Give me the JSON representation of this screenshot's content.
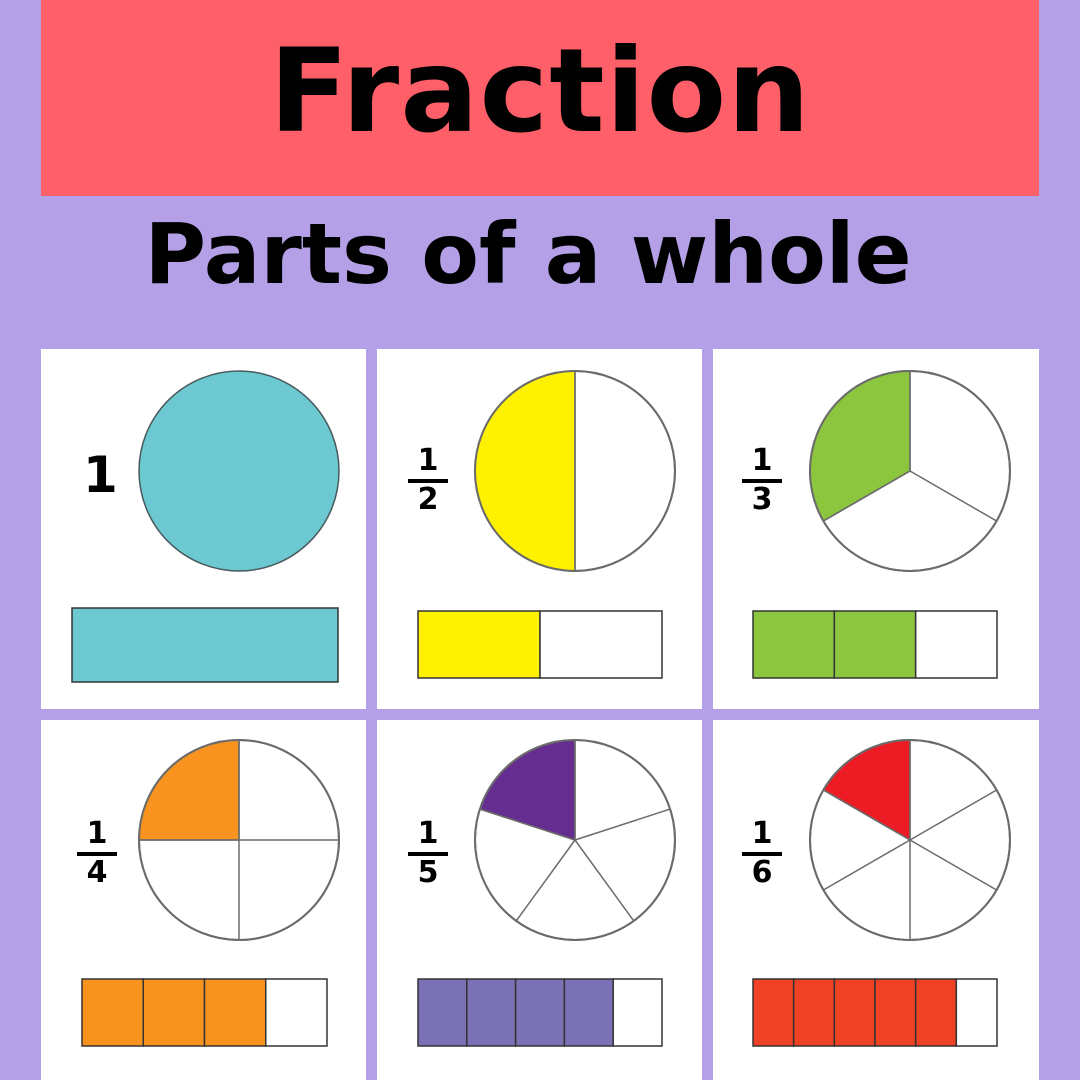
{
  "title": "Fraction",
  "subtitle": "Parts of a whole",
  "colors": {
    "background": "#b3a0e6",
    "banner": "#ff5f68",
    "card": "#ffffff",
    "outline": "#6b6b6b"
  },
  "cards": [
    {
      "label": "1",
      "parts": 1,
      "shaded": 1,
      "circle_color": "#6cc9d1",
      "bar_color": "#6cc9d1",
      "bar_shaded": 1
    },
    {
      "numerator": "1",
      "denominator": "2",
      "parts": 2,
      "shaded": 1,
      "circle_color": "#fff200",
      "bar_color": "#fff200",
      "bar_shaded": 1
    },
    {
      "numerator": "1",
      "denominator": "3",
      "parts": 3,
      "shaded": 1,
      "circle_color": "#8cc63f",
      "bar_color": "#8cc63f",
      "bar_shaded": 2
    },
    {
      "numerator": "1",
      "denominator": "4",
      "parts": 4,
      "shaded": 1,
      "circle_color": "#f7931e",
      "bar_color": "#f7931e",
      "bar_shaded": 3
    },
    {
      "numerator": "1",
      "denominator": "5",
      "parts": 5,
      "shaded": 1,
      "circle_color": "#662d91",
      "bar_color": "#7b71b5",
      "bar_shaded": 4
    },
    {
      "numerator": "1",
      "denominator": "6",
      "parts": 6,
      "shaded": 1,
      "circle_color": "#ed1c24",
      "bar_color": "#ef4123",
      "bar_shaded": 5
    }
  ]
}
